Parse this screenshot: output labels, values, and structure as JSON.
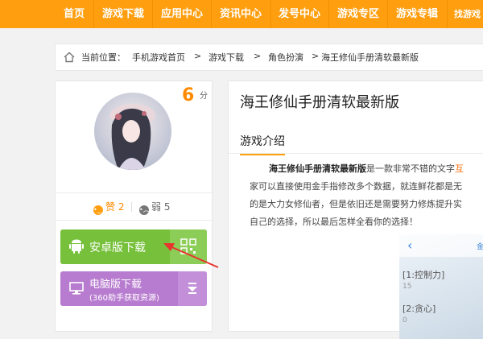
{
  "nav": {
    "items": [
      "首页",
      "游戏下载",
      "应用中心",
      "资讯中心",
      "发号中心",
      "游戏专区",
      "游戏专辑",
      "找游戏"
    ]
  },
  "breadcrumb": {
    "prefix": "当前位置：",
    "items": [
      "手机游戏首页",
      ">",
      "游戏下载",
      ">",
      "角色扮演",
      ">",
      "海王修仙手册清软最新版"
    ]
  },
  "game": {
    "score": "6",
    "score_unit": "分",
    "like_label": "赞",
    "like_count": "2",
    "dislike_label": "弱",
    "dislike_count": "5"
  },
  "download": {
    "android_label": "安卓版下载",
    "pc_label": "电脑版下载",
    "pc_sub": "(360助手获取资源)"
  },
  "main": {
    "title": "海王修仙手册清软最新版",
    "tab": "游戏介绍",
    "intro_bold": "海王修仙手册清软最新版",
    "intro_line1_rest": "是一款非常不错的文字",
    "intro_line1_hl": "互",
    "intro_line2": "家可以直接使用金手指修改多个数据，就连鲜花都是无",
    "intro_line3": "的是大力女修仙者，但是依旧还是需要努力修炼提升实",
    "intro_line4": "自己的选择，所以最后怎样全看你的选择！"
  },
  "screenshot": {
    "row1": "[1:控制力]",
    "num1": "15",
    "row2": "[2:贪心]",
    "num2": "0",
    "corner": "金"
  },
  "colors": {
    "nav_bg": "#ff9e0e",
    "android_btn": "#76c03b",
    "pc_btn": "#b77bcf",
    "score": "#ff8a00",
    "highlight": "#ff6600"
  }
}
